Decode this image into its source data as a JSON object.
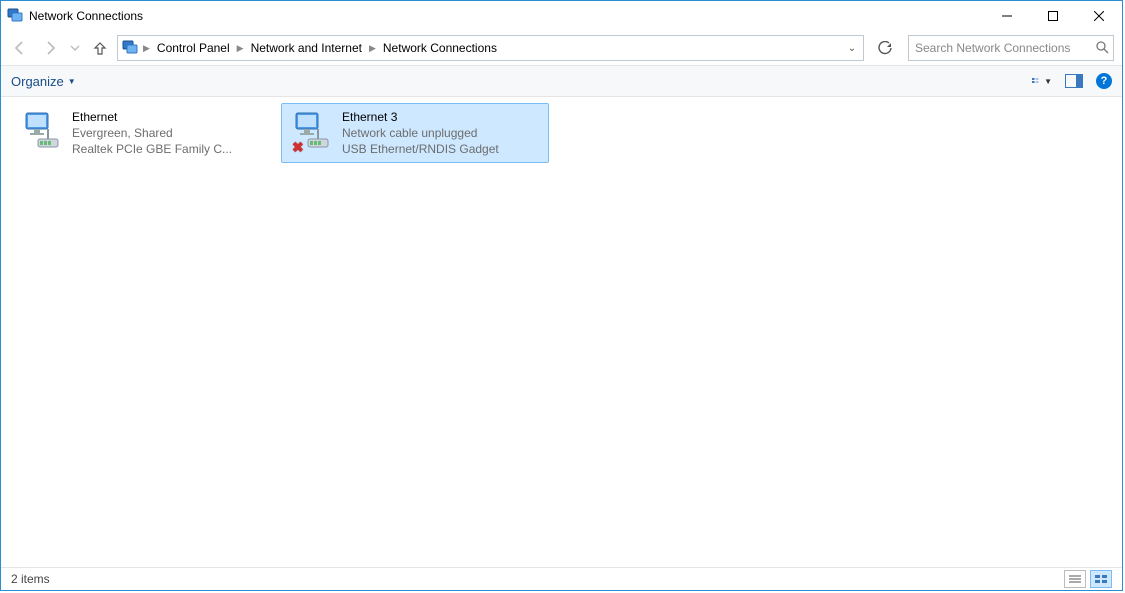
{
  "window": {
    "title": "Network Connections"
  },
  "breadcrumb": {
    "items": [
      "Control Panel",
      "Network and Internet",
      "Network Connections"
    ]
  },
  "search": {
    "placeholder": "Search Network Connections"
  },
  "commandbar": {
    "organize": "Organize"
  },
  "connections": [
    {
      "name": "Ethernet",
      "status": "Evergreen, Shared",
      "device": "Realtek PCIe GBE Family C...",
      "unplugged": false,
      "selected": false
    },
    {
      "name": "Ethernet 3",
      "status": "Network cable unplugged",
      "device": "USB Ethernet/RNDIS Gadget",
      "unplugged": true,
      "selected": true
    }
  ],
  "statusbar": {
    "text": "2 items"
  }
}
